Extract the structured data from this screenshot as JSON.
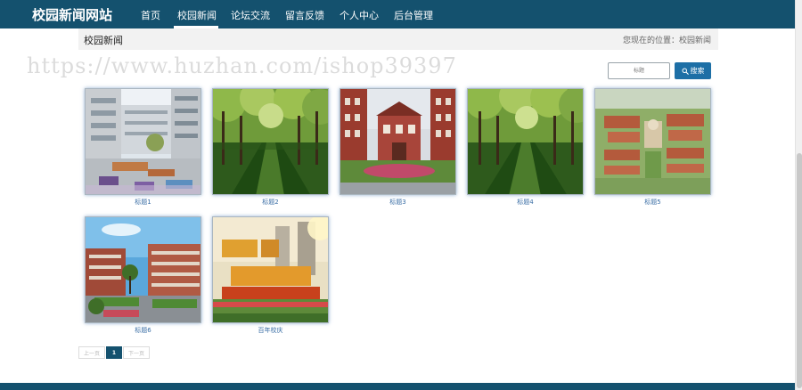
{
  "site": {
    "title": "校园新闻网站"
  },
  "nav": {
    "items": [
      "首页",
      "校园新闻",
      "论坛交流",
      "留言反馈",
      "个人中心",
      "后台管理"
    ],
    "active_index": 1
  },
  "breadcrumb": {
    "title": "校园新闻",
    "location": "您现在的位置：校园新闻"
  },
  "watermark": "https://www.huzhan.com/ishop39397",
  "search": {
    "placeholder": "标题",
    "button_label": "搜索",
    "icon": "search-icon"
  },
  "news": [
    {
      "caption": "标题1"
    },
    {
      "caption": "标题2"
    },
    {
      "caption": "标题3"
    },
    {
      "caption": "标题4"
    },
    {
      "caption": "标题5"
    },
    {
      "caption": "标题6"
    },
    {
      "caption": "百年校庆"
    }
  ],
  "pagination": {
    "prev": "上一页",
    "current": "1",
    "next": "下一页"
  },
  "colors": {
    "navbar": "#14516e",
    "search_button": "#1d6fa6",
    "caption": "#3a6ea5",
    "crumb_background": "#f2f2f2"
  }
}
